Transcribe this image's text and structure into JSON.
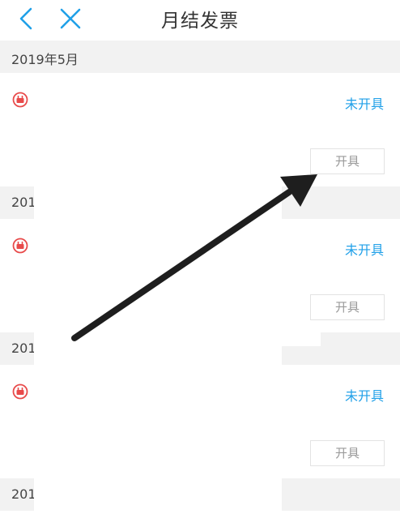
{
  "nav": {
    "title": "月结发票",
    "back_icon": "back-icon",
    "close_icon": "close-icon"
  },
  "months": [
    "2019年5月",
    "201",
    "201",
    "201"
  ],
  "cards": [
    {
      "status": "未开具",
      "button": "开具"
    },
    {
      "status": "未开具",
      "button": "开具"
    },
    {
      "status": "未开具",
      "button": "开具"
    }
  ],
  "colors": {
    "accent": "#20a0e8",
    "icon": "#e84a4a",
    "arrow": "#1e1e1e",
    "header_bg": "#f2f2f2"
  }
}
